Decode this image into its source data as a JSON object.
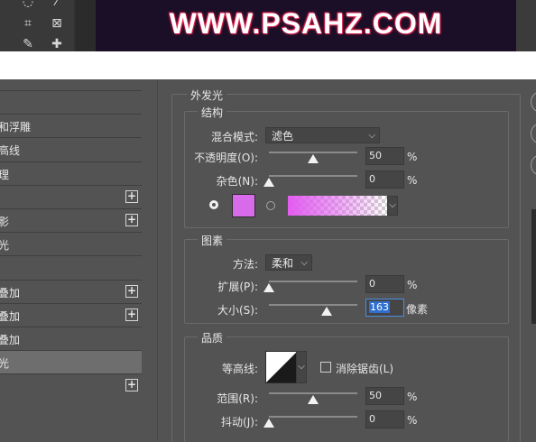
{
  "banner": {
    "text": "WWW.PSAHZ.COM"
  },
  "style_list": {
    "items": [
      {
        "label": "",
        "plus": false,
        "selected": false
      },
      {
        "label": "和浮雕",
        "plus": false,
        "selected": false
      },
      {
        "label": "高线",
        "plus": false,
        "selected": false
      },
      {
        "label": "理",
        "plus": false,
        "selected": false
      },
      {
        "label": "",
        "plus": true,
        "selected": false
      },
      {
        "label": "影",
        "plus": true,
        "selected": false
      },
      {
        "label": "光",
        "plus": false,
        "selected": false
      },
      {
        "label": "",
        "plus": false,
        "selected": false
      },
      {
        "label": "叠加",
        "plus": true,
        "selected": false
      },
      {
        "label": "叠加",
        "plus": true,
        "selected": false
      },
      {
        "label": "叠加",
        "plus": false,
        "selected": false
      },
      {
        "label": "光",
        "plus": false,
        "selected": true
      },
      {
        "label": "",
        "plus": true,
        "selected": false
      }
    ]
  },
  "outer_glow": {
    "title": "外发光",
    "structure": {
      "title": "结构",
      "blend_mode_label": "混合模式:",
      "blend_mode_value": "滤色",
      "opacity_label": "不透明度(O):",
      "opacity_value": "50",
      "opacity_fraction": 0.5,
      "noise_label": "杂色(N):",
      "noise_value": "0",
      "noise_fraction": 0,
      "percent_unit": "%",
      "glow_color": "#d86bea",
      "gradient_from": "#e25cf0"
    },
    "elements": {
      "title": "图素",
      "technique_label": "方法:",
      "technique_value": "柔和",
      "spread_label": "扩展(P):",
      "spread_value": "0",
      "spread_fraction": 0,
      "size_label": "大小(S):",
      "size_value": "163",
      "size_fraction": 0.65,
      "size_unit": "像素",
      "percent_unit": "%"
    },
    "quality": {
      "title": "品质",
      "contour_label": "等高线:",
      "antialias_label": "消除锯齿(L)",
      "range_label": "范围(R):",
      "range_value": "50",
      "range_fraction": 0.5,
      "jitter_label": "抖动(J):",
      "jitter_value": "0",
      "jitter_fraction": 0,
      "percent_unit": "%"
    }
  }
}
